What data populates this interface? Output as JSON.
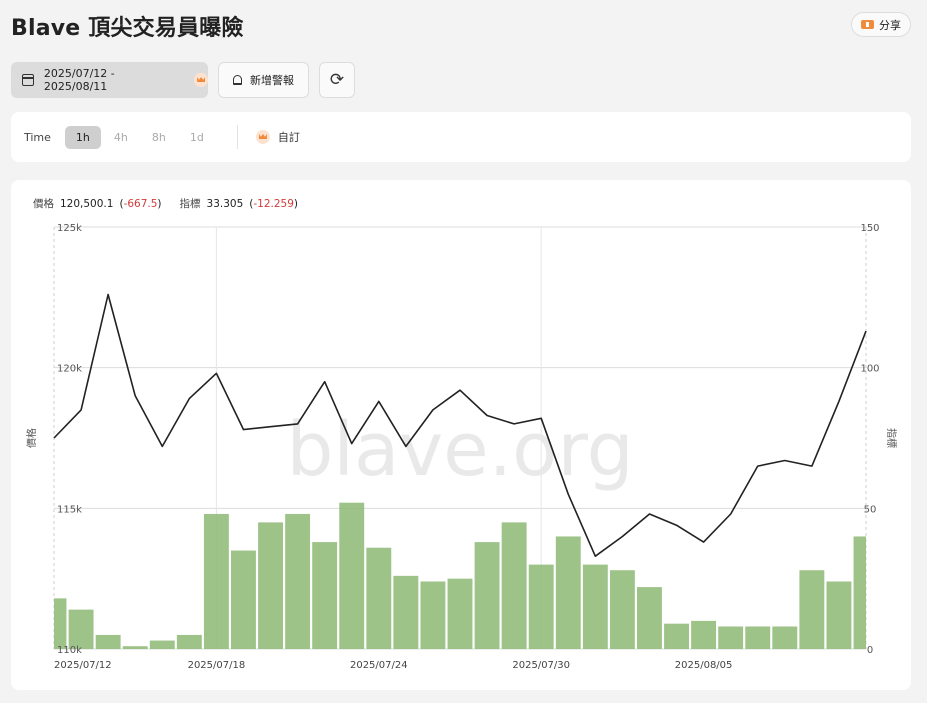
{
  "header": {
    "title": "Blave 頂尖交易員曝險",
    "share_label": "分享"
  },
  "toolbar": {
    "date_range": "2025/07/12 - 2025/08/11",
    "alert_label": "新增警報"
  },
  "time": {
    "label": "Time",
    "options": [
      "1h",
      "4h",
      "8h",
      "1d"
    ],
    "selected": "1h",
    "custom_label": "自訂"
  },
  "legend": {
    "price_label": "價格",
    "price_value": "120,500.1",
    "price_change": "-667.5",
    "indicator_label": "指標",
    "indicator_value": "33.305",
    "indicator_change": "-12.259"
  },
  "watermark": "blave.org",
  "colors": {
    "price_line": "#222222",
    "indicator_bars": "#8db873",
    "negative": "#d23b3b"
  },
  "chart_data": {
    "type": "line+bar",
    "x_ticks": [
      "2025/07/12",
      "2025/07/18",
      "2025/07/24",
      "2025/07/30",
      "2025/08/05"
    ],
    "y_left": {
      "label": "價格",
      "ticks": [
        "110k",
        "115k",
        "120k",
        "125k"
      ],
      "range": [
        110000,
        125000
      ]
    },
    "y_right": {
      "label": "指標",
      "ticks": [
        "0",
        "50",
        "100",
        "150"
      ],
      "range": [
        0,
        150
      ]
    },
    "series": [
      {
        "axis": "left",
        "kind": "line",
        "x": [
          "2025/07/12",
          "2025/07/13",
          "2025/07/14",
          "2025/07/15",
          "2025/07/16",
          "2025/07/17",
          "2025/07/18",
          "2025/07/19",
          "2025/07/20",
          "2025/07/21",
          "2025/07/22",
          "2025/07/23",
          "2025/07/24",
          "2025/07/25",
          "2025/07/26",
          "2025/07/27",
          "2025/07/28",
          "2025/07/29",
          "2025/07/30",
          "2025/07/31",
          "2025/08/01",
          "2025/08/02",
          "2025/08/03",
          "2025/08/04",
          "2025/08/05",
          "2025/08/06",
          "2025/08/07",
          "2025/08/08",
          "2025/08/09",
          "2025/08/10",
          "2025/08/11"
        ],
        "values": [
          117500,
          118500,
          122600,
          119000,
          117200,
          118900,
          119800,
          117800,
          117900,
          118000,
          119500,
          117300,
          118800,
          117200,
          118500,
          119200,
          118300,
          118000,
          118200,
          115500,
          113300,
          114000,
          114800,
          114400,
          113800,
          114800,
          116500,
          116700,
          116500,
          118800,
          121300
        ]
      },
      {
        "axis": "right",
        "kind": "bar",
        "x": [
          "2025/07/12",
          "2025/07/13",
          "2025/07/14",
          "2025/07/15",
          "2025/07/16",
          "2025/07/17",
          "2025/07/18",
          "2025/07/19",
          "2025/07/20",
          "2025/07/21",
          "2025/07/22",
          "2025/07/23",
          "2025/07/24",
          "2025/07/25",
          "2025/07/26",
          "2025/07/27",
          "2025/07/28",
          "2025/07/29",
          "2025/07/30",
          "2025/07/31",
          "2025/08/01",
          "2025/08/02",
          "2025/08/03",
          "2025/08/04",
          "2025/08/05",
          "2025/08/06",
          "2025/08/07",
          "2025/08/08",
          "2025/08/09",
          "2025/08/10",
          "2025/08/11"
        ],
        "values": [
          18,
          14,
          5,
          1,
          3,
          5,
          48,
          35,
          45,
          48,
          38,
          52,
          36,
          26,
          24,
          25,
          38,
          45,
          30,
          40,
          30,
          28,
          22,
          9,
          10,
          8,
          8,
          8,
          28,
          24,
          40
        ]
      }
    ]
  }
}
